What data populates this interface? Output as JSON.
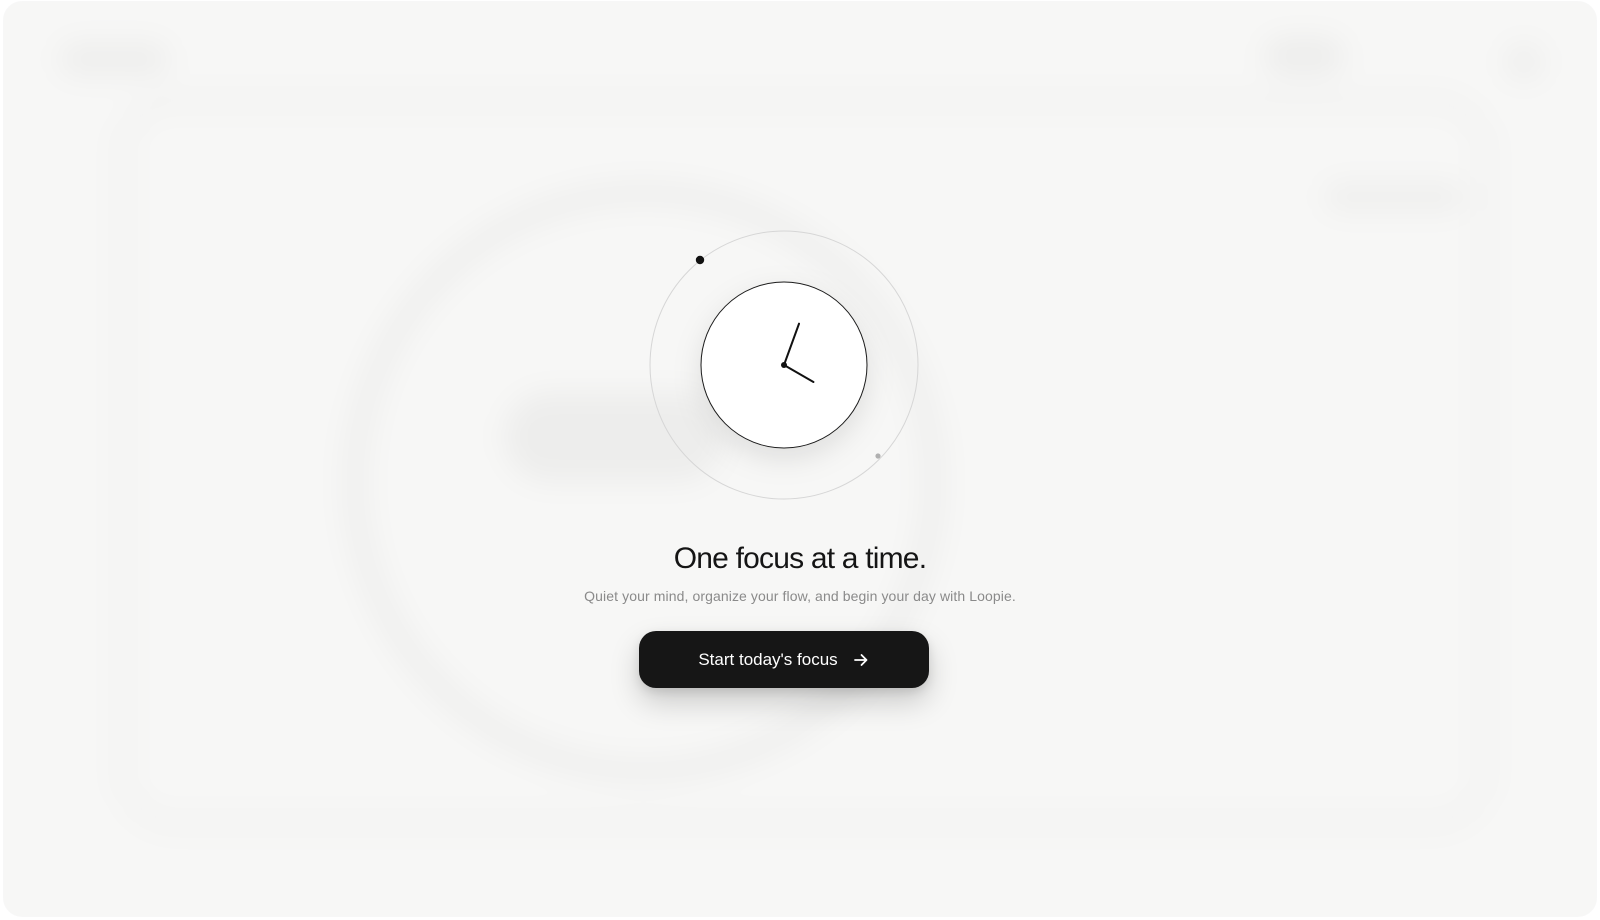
{
  "hero": {
    "title": "One focus at a time.",
    "subtitle": "Quiet your mind, organize your flow, and begin your day with Loopie.",
    "cta_label": "Start today's focus",
    "cta_icon": "arrow-right-icon"
  },
  "clock": {
    "hour_hand_angle_deg": 120,
    "minute_hand_angle_deg": 20,
    "colors": {
      "face": "#ffffff",
      "stroke": "#1a1a1a",
      "orbit": "#d6d6d6",
      "orbit_dot_primary": "#111111",
      "orbit_dot_secondary": "#b0b0b0"
    }
  },
  "colors": {
    "background": "#f7f7f6",
    "button_bg": "#161616",
    "button_text": "#ffffff",
    "title": "#151515",
    "subtitle": "#8a8a8a"
  }
}
